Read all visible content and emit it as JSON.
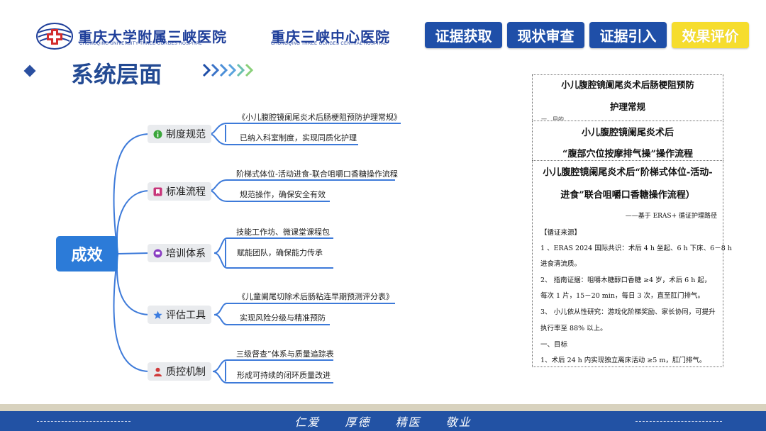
{
  "header": {
    "hospital1_cn": "重庆大学附属三峡医院",
    "hospital1_en": "CHONGQING UNIVERSITY THREE GORGES HOSPITAL",
    "hospital2_cn": "重庆三峡中心医院",
    "hospital2_en": "CHONGQING THREE GORGES CENTRAL HOSPITAL",
    "tabs": [
      {
        "label": "证据获取"
      },
      {
        "label": "现状审查"
      },
      {
        "label": "证据引入"
      },
      {
        "label": "效果评价"
      }
    ],
    "active_tab_color": "#f6dd2e",
    "tab_color": "#1f4fa8"
  },
  "section_title": "系统层面",
  "mindmap": {
    "root": "成效",
    "branches": [
      {
        "label": "制度规范",
        "icon": "info-icon",
        "leaves": [
          "《小儿腹腔镜阑尾炎术后肠梗阻预防护理常规》",
          "已纳入科室制度，实现同质化护理"
        ]
      },
      {
        "label": "标准流程",
        "icon": "bookmark-icon",
        "leaves": [
          "阶梯式体位-活动进食-联合咀嚼口香糖操作流程",
          "规范操作，确保安全有效"
        ]
      },
      {
        "label": "培训体系",
        "icon": "chat-icon",
        "leaves": [
          "技能工作坊、微课堂课程包",
          "赋能团队，确保能力传承"
        ]
      },
      {
        "label": "评估工具",
        "icon": "star-icon",
        "leaves": [
          "《儿童阑尾切除术后肠粘连早期预测评分表》",
          "实现风险分级与精准预防"
        ]
      },
      {
        "label": "质控机制",
        "icon": "person-icon",
        "leaves": [
          "三级督查”体系与质量追踪表",
          "形成可持续的闭环质量改进"
        ]
      }
    ]
  },
  "documents": {
    "doc1": {
      "title_line1": "小儿腹腔镜阑尾炎术后肠梗阻预防",
      "title_line2": "护理常规",
      "partial": "一、目的"
    },
    "doc2": {
      "title_line1": "小儿腹腔镜阑尾炎术后",
      "title_line2": "“腹部穴位按摩排气操”操作流程"
    },
    "doc3": {
      "title_line1": "小儿腹腔镜阑尾炎术后“阶梯式体位-活动-",
      "title_line2": "进食”联合咀嚼口香糖操作流程）",
      "subtitle": "——基于 ERAS+ 循证护理路径",
      "lines": [
        "【循证来源】",
        "1 、ERAS 2024 国际共识：术后 4 h 坐起、6 h 下床、6－8 h",
        "进食清流质。",
        "2、 指南证据：咀嚼木糖醇口香糖 ≥4 岁，术后 6 h 起，",
        "每次 1 片，15－20 min，每日 3 次，直至肛门排气。",
        "3、 小儿依从性研究：游戏化阶梯奖励、家长协同，可提升",
        "执行率至 88% 以上。",
        "一、目标",
        "1、术后 24 h 内实现独立离床活动 ≥5 m，肛门排气。"
      ]
    }
  },
  "footer": {
    "motto": [
      "仁爱",
      "厚德",
      "精医",
      "敬业"
    ]
  }
}
